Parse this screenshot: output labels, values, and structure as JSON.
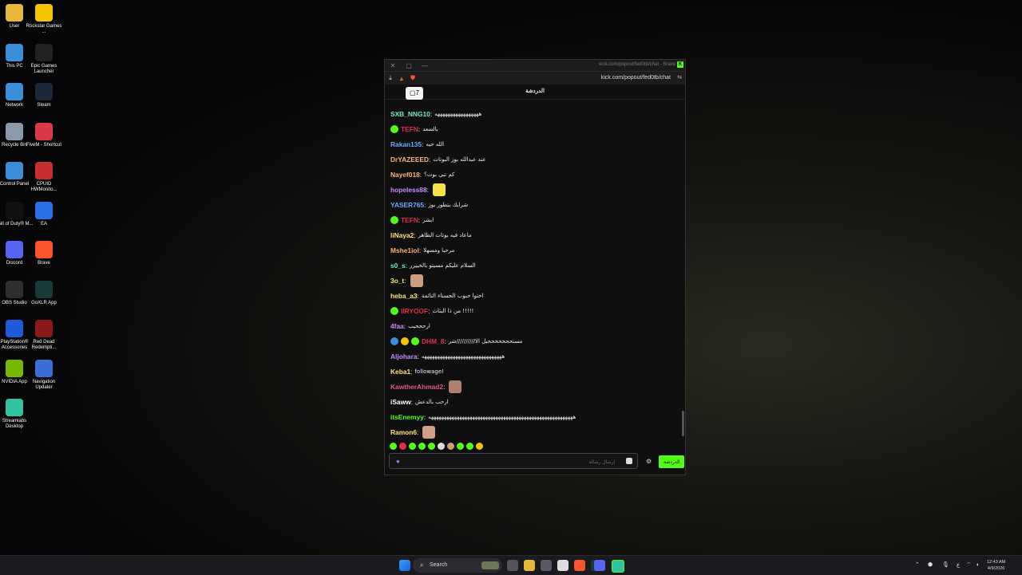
{
  "desktop": {
    "icons": [
      {
        "label": "User",
        "icon": "folder-icon",
        "color": "#e8b83a"
      },
      {
        "label": "Rockstar Games ...",
        "icon": "rockstar-icon",
        "color": "#f5c400"
      },
      {
        "label": "This PC",
        "icon": "monitor-icon",
        "color": "#3a8fd8"
      },
      {
        "label": "Epic Games Launcher",
        "icon": "epic-games-icon",
        "color": "#222222"
      },
      {
        "label": "Network",
        "icon": "network-icon",
        "color": "#3a8fd8"
      },
      {
        "label": "Steam",
        "icon": "steam-icon",
        "color": "#1b2838"
      },
      {
        "label": "Recycle Bin",
        "icon": "recycle-bin-icon",
        "color": "#8a9aa8"
      },
      {
        "label": "FiveM - Shortcut",
        "icon": "fivem-icon",
        "color": "#d83a4a"
      },
      {
        "label": "Control Panel",
        "icon": "control-panel-icon",
        "color": "#3a8fd8"
      },
      {
        "label": "CPUID HWMonito...",
        "icon": "hwmonitor-icon",
        "color": "#c83030"
      },
      {
        "label": "Call of Duty® M...",
        "icon": "call-of-duty-icon",
        "color": "#111111"
      },
      {
        "label": "EA",
        "icon": "ea-icon",
        "color": "#2b6fe8"
      },
      {
        "label": "Discord",
        "icon": "discord-icon",
        "color": "#5865f2"
      },
      {
        "label": "Brave",
        "icon": "brave-icon",
        "color": "#fb542b"
      },
      {
        "label": "OBS Studio",
        "icon": "obs-icon",
        "color": "#302e31"
      },
      {
        "label": "GoXLR App",
        "icon": "goxlr-icon",
        "color": "#1a3a3a"
      },
      {
        "label": "PlayStation® Accessories",
        "icon": "playstation-icon",
        "color": "#1e5bd8"
      },
      {
        "label": "Red Dead Redempti...",
        "icon": "red-dead-icon",
        "color": "#8a1a1a"
      },
      {
        "label": "NVIDIA App",
        "icon": "nvidia-icon",
        "color": "#76b900"
      },
      {
        "label": "Navigation Updater",
        "icon": "navigation-updater-icon",
        "color": "#3a6fd8"
      },
      {
        "label": "Streamlabs Desktop",
        "icon": "streamlabs-icon",
        "color": "#31c3a2"
      }
    ]
  },
  "window": {
    "title": "kick.com/popout/fed0tb/chat - Brave",
    "url": "kick.com/popout/fed0tb/chat",
    "chat_header": "الدردشة"
  },
  "chat": {
    "messages": [
      {
        "user": "SXB_NNG10",
        "color": "#7de3c8",
        "text": "هههههههههههههههههه",
        "badges": [],
        "emote": false
      },
      {
        "user": "TEFN",
        "color": "#e0304a",
        "text": "بالسعد",
        "badges": [
          "#53fc18"
        ],
        "emote": false
      },
      {
        "user": "Rakan135",
        "color": "#6fa8ff",
        "text": "الله حيه",
        "badges": [],
        "emote": false
      },
      {
        "user": "DrYAZEEED",
        "color": "#ffb07a",
        "text": "عند عبدالله بوز البوتات",
        "badges": [],
        "emote": false
      },
      {
        "user": "Nayef018",
        "color": "#ffb07a",
        "text": "كم تبي بوت؟",
        "badges": [],
        "emote": false
      },
      {
        "user": "hopeless88",
        "color": "#c58cff",
        "text": "",
        "badges": [],
        "emote": true,
        "emote_color": "#f5e04a"
      },
      {
        "user": "YASER765",
        "color": "#6fa8ff",
        "text": "شرايك بتطور بوز",
        "badges": [],
        "emote": false
      },
      {
        "user": "TEFN",
        "color": "#e0304a",
        "text": "ابشر",
        "badges": [
          "#53fc18"
        ],
        "emote": false
      },
      {
        "user": "liNaya2",
        "color": "#ffe27a",
        "text": "ماعاد فيه بوتات الظاهر",
        "badges": [],
        "emote": false
      },
      {
        "user": "Mshe1iol",
        "color": "#ffb07a",
        "text": "مرحبا ومسهلا",
        "badges": [],
        "emote": false
      },
      {
        "user": "s0_s",
        "color": "#7de3c8",
        "text": "السلام عليكم مسيتو بالخييرر",
        "badges": [],
        "emote": false
      },
      {
        "user": "3o_t",
        "color": "#ffe27a",
        "text": "",
        "badges": [],
        "emote": true,
        "emote_color": "#c8a080"
      },
      {
        "user": "heba_a3",
        "color": "#ffe27a",
        "text": "اختوا حبوب الحسناء النائمة",
        "badges": [],
        "emote": false
      },
      {
        "user": "IIRYOOF",
        "color": "#e0304a",
        "text": "من ذا البثاث !!!!!",
        "badges": [
          "#53fc18"
        ],
        "emote": false
      },
      {
        "user": "4faa",
        "color": "#c58cff",
        "text": "ارحححيب",
        "badges": [],
        "emote": false
      },
      {
        "user": "DHM_8",
        "color": "#e0304a",
        "text": "مستحححححححيل الا//////////شر",
        "badges": [
          "#3a8fd8",
          "#f5c400",
          "#53fc18"
        ],
        "emote": false
      },
      {
        "user": "Aljohara",
        "color": "#c58cff",
        "text": "هههههههههههههههههههههههههههههههه",
        "badges": [],
        "emote": false
      },
      {
        "user": "Keba1",
        "color": "#ffe27a",
        "text": "followage!",
        "badges": [],
        "emote": false
      },
      {
        "user": "KawtherAhmad2",
        "color": "#e05a8a",
        "text": "",
        "badges": [],
        "emote": true,
        "emote_color": "#b0806a"
      },
      {
        "user": "iSaww",
        "color": "#ffffff",
        "text": "ارحب بالدعش",
        "badges": [],
        "emote": false
      },
      {
        "user": "itsEnemyy",
        "color": "#53fc18",
        "text": "ههههههههههههههههههههههههههههههههههههههههههههههههههههههههه",
        "badges": [],
        "emote": false
      },
      {
        "user": "Ramon6",
        "color": "#ffe27a",
        "text": "",
        "badges": [],
        "emote": true,
        "emote_color": "#d0a088"
      }
    ],
    "input_placeholder": "إرسال رسالة",
    "send_label": "الدردشة"
  },
  "taskbar": {
    "search_label": "Search",
    "language": "ع",
    "time": "12:43 AM",
    "date": "4/9/2026"
  },
  "colors": {
    "kick_green": "#53fc18"
  }
}
